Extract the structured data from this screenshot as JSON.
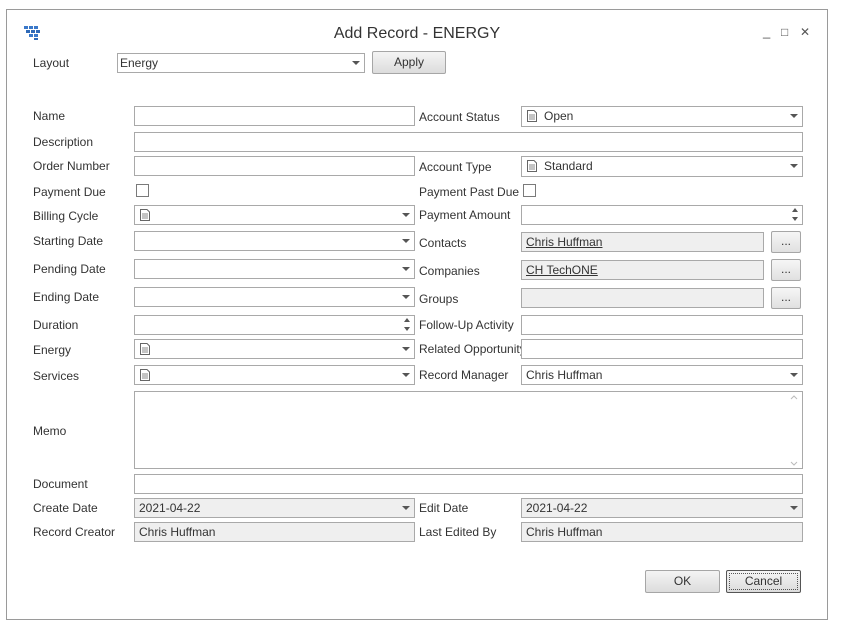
{
  "window": {
    "title": "Add Record - ENERGY",
    "minimize_glyph": "_",
    "maximize_glyph": "□",
    "close_glyph": "✕",
    "app_icon": "grid-app-icon"
  },
  "layout": {
    "label": "Layout",
    "value": "Energy",
    "apply_label": "Apply"
  },
  "left": {
    "name": {
      "label": "Name",
      "value": ""
    },
    "description": {
      "label": "Description",
      "value": ""
    },
    "order_number": {
      "label": "Order Number",
      "value": ""
    },
    "payment_due": {
      "label": "Payment Due",
      "checked": false
    },
    "billing_cycle": {
      "label": "Billing Cycle",
      "value": ""
    },
    "starting_date": {
      "label": "Starting Date",
      "value": ""
    },
    "pending_date": {
      "label": "Pending Date",
      "value": ""
    },
    "ending_date": {
      "label": "Ending Date",
      "value": ""
    },
    "duration": {
      "label": "Duration",
      "value": ""
    },
    "energy": {
      "label": "Energy",
      "value": ""
    },
    "services": {
      "label": "Services",
      "value": ""
    },
    "memo": {
      "label": "Memo",
      "value": ""
    },
    "document": {
      "label": "Document",
      "value": ""
    },
    "create_date": {
      "label": "Create Date",
      "value": "2021-04-22"
    },
    "record_creator": {
      "label": "Record Creator",
      "value": "Chris Huffman"
    }
  },
  "right": {
    "account_status": {
      "label": "Account Status",
      "value": "Open"
    },
    "account_type": {
      "label": "Account Type",
      "value": "Standard"
    },
    "payment_past_due": {
      "label": "Payment Past Due",
      "checked": false
    },
    "payment_amount": {
      "label": "Payment Amount",
      "value": ""
    },
    "contacts": {
      "label": "Contacts",
      "value": "Chris Huffman",
      "button": "..."
    },
    "companies": {
      "label": "Companies",
      "value": "CH TechONE",
      "button": "..."
    },
    "groups": {
      "label": "Groups",
      "value": "",
      "button": "..."
    },
    "follow_up_activity": {
      "label": "Follow-Up Activity",
      "value": ""
    },
    "related_opportunity": {
      "label": "Related Opportunity",
      "value": ""
    },
    "record_manager": {
      "label": "Record Manager",
      "value": "Chris Huffman"
    },
    "edit_date": {
      "label": "Edit Date",
      "value": "2021-04-22"
    },
    "last_edited_by": {
      "label": "Last Edited By",
      "value": "Chris Huffman"
    }
  },
  "footer": {
    "ok_label": "OK",
    "cancel_label": "Cancel"
  },
  "colors": {
    "link": "#1a2bb3",
    "readonly_bg": "#efefef",
    "border": "#a9a9a9"
  }
}
